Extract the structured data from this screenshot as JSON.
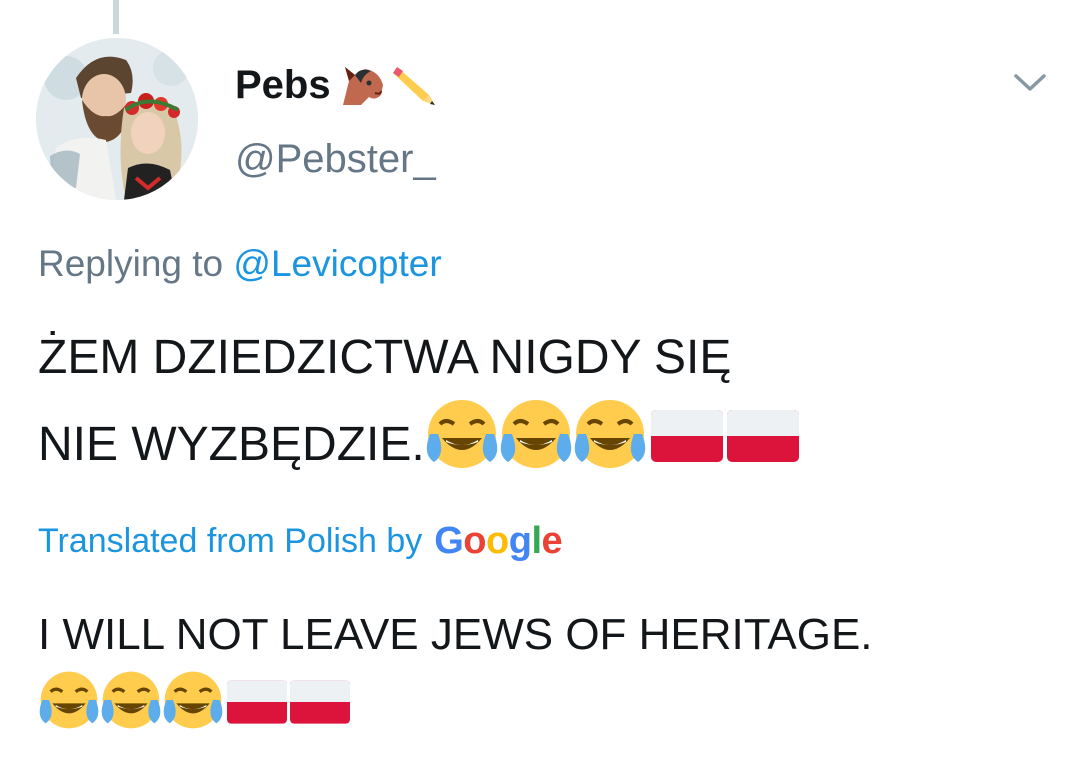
{
  "tweet": {
    "display_name": "Pebs",
    "name_emojis": [
      "horse-face-icon",
      "pencil-icon"
    ],
    "handle": "@Pebster_",
    "reply_prefix": "Replying to",
    "reply_to": "@Levicopter",
    "text_line1": "ŻEM DZIEDZICTWA NIGDY SIĘ",
    "text_line2": "NIE WYZBĘDZIE.",
    "text_emojis": [
      "face-with-tears-of-joy-icon",
      "face-with-tears-of-joy-icon",
      "face-with-tears-of-joy-icon",
      "flag-poland-icon",
      "flag-poland-icon"
    ],
    "translated_label": "Translated from Polish by",
    "translator_brand": "Google",
    "translation_text": "I WILL NOT LEAVE JEWS OF HERITAGE."
  },
  "colors": {
    "text": "#14171a",
    "secondary": "#657786",
    "link": "#1b95e0",
    "thread_line": "#ccd6dd",
    "google_blue": "#4285f4",
    "google_red": "#ea4335",
    "google_yellow": "#fbbc05",
    "google_green": "#34a853",
    "flag_red": "#dc143c",
    "flag_white": "#f5f8fa"
  }
}
